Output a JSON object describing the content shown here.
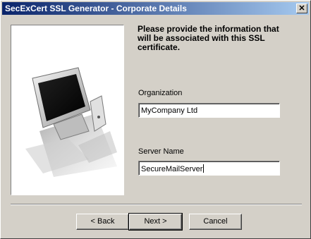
{
  "window": {
    "title": "SecExCert SSL Generator - Corporate Details",
    "close_glyph": "✕"
  },
  "intro": {
    "text": "Please provide the information that will be associated with this SSL certificate."
  },
  "fields": {
    "organization": {
      "label": "Organization",
      "value": "MyCompany Ltd"
    },
    "server_name": {
      "label": "Server Name",
      "value": "SecureMailServer"
    }
  },
  "buttons": {
    "back": "< Back",
    "next": "Next >",
    "cancel": "Cancel"
  },
  "illustration": {
    "icon": "computer-monitor-illustration"
  }
}
